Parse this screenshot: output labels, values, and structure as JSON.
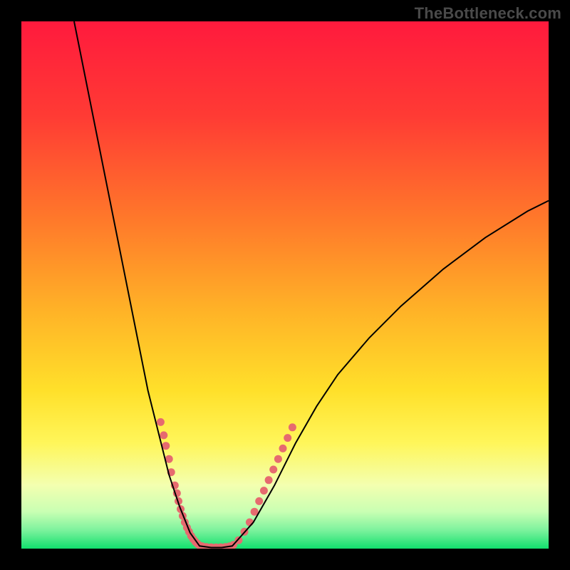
{
  "watermark": "TheBottleneck.com",
  "chart_data": {
    "type": "line",
    "title": "",
    "xlabel": "",
    "ylabel": "",
    "xlim": [
      0,
      100
    ],
    "ylim": [
      0,
      100
    ],
    "gradient_stops": [
      {
        "offset": 0.0,
        "color": "#ff1a3d"
      },
      {
        "offset": 0.18,
        "color": "#ff3b34"
      },
      {
        "offset": 0.38,
        "color": "#ff7a2a"
      },
      {
        "offset": 0.55,
        "color": "#ffb327"
      },
      {
        "offset": 0.7,
        "color": "#ffe02a"
      },
      {
        "offset": 0.8,
        "color": "#fff65a"
      },
      {
        "offset": 0.88,
        "color": "#f3ffb0"
      },
      {
        "offset": 0.93,
        "color": "#c9ffb3"
      },
      {
        "offset": 0.965,
        "color": "#7cf29d"
      },
      {
        "offset": 1.0,
        "color": "#12e06e"
      }
    ],
    "series": [
      {
        "name": "left-branch",
        "x": [
          10,
          12,
          14,
          16,
          18,
          20,
          22,
          24,
          26,
          28,
          30,
          32,
          33.8
        ],
        "y": [
          100,
          90,
          80,
          70,
          60,
          50,
          40,
          30,
          22,
          14,
          8,
          3,
          0.5
        ],
        "stroke": "#000000",
        "stroke_width": 2
      },
      {
        "name": "valley",
        "x": [
          33.8,
          36,
          38,
          40
        ],
        "y": [
          0.5,
          0.2,
          0.2,
          0.5
        ],
        "stroke": "#000000",
        "stroke_width": 2
      },
      {
        "name": "right-branch",
        "x": [
          40,
          44,
          48,
          52,
          56,
          60,
          66,
          72,
          80,
          88,
          96,
          100
        ],
        "y": [
          0.5,
          5,
          12,
          20,
          27,
          33,
          40,
          46,
          53,
          59,
          64,
          66
        ],
        "stroke": "#000000",
        "stroke_width": 2
      },
      {
        "name": "pink-dotted-left",
        "x": [
          26.4,
          27.0,
          27.4,
          28.0,
          28.4,
          29.1,
          29.5,
          29.8,
          30.2,
          30.6,
          31.0,
          31.4,
          31.8,
          32.2,
          32.6,
          33.0,
          33.4,
          33.8
        ],
        "y": [
          24.0,
          21.5,
          19.5,
          17.0,
          14.5,
          12.0,
          10.5,
          9.0,
          7.5,
          6.2,
          5.0,
          4.0,
          3.2,
          2.4,
          1.8,
          1.3,
          0.9,
          0.6
        ],
        "stroke": "#e66a6f",
        "style": "dotted",
        "stroke_width": 11
      },
      {
        "name": "pink-dotted-bottom",
        "x": [
          34.3,
          35.1,
          36.0,
          36.9,
          37.8,
          38.7,
          39.5
        ],
        "y": [
          0.45,
          0.3,
          0.25,
          0.23,
          0.25,
          0.3,
          0.45
        ],
        "stroke": "#e66a6f",
        "style": "dotted",
        "stroke_width": 11
      },
      {
        "name": "pink-dotted-right",
        "x": [
          40.2,
          41.2,
          42.3,
          43.3,
          44.2,
          45.1,
          46.0,
          46.9,
          47.8,
          48.7,
          49.6,
          50.5,
          51.4
        ],
        "y": [
          0.7,
          1.6,
          3.2,
          5.0,
          7.0,
          9.0,
          11.0,
          13.0,
          15.0,
          17.0,
          19.0,
          21.0,
          23.0
        ],
        "stroke": "#e66a6f",
        "style": "dotted",
        "stroke_width": 11
      }
    ]
  }
}
